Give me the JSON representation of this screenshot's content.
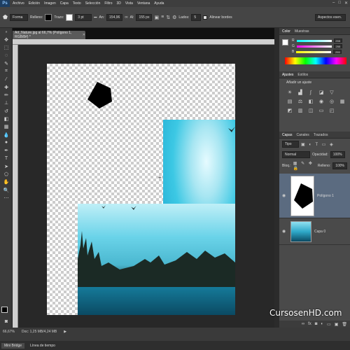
{
  "app": {
    "logo": "Ps"
  },
  "menu": [
    "Archivo",
    "Edición",
    "Imagen",
    "Capa",
    "Texto",
    "Selección",
    "Filtro",
    "3D",
    "Vista",
    "Ventana",
    "Ayuda"
  ],
  "options": {
    "mode": "Forma",
    "fill_label": "Relleno:",
    "stroke_label": "Trazo:",
    "stroke_width": "3 pt",
    "w_label": "An:",
    "w_value": "154,96",
    "h_label": "Al:",
    "h_value": "155 px",
    "sides_label": "Lados:",
    "sides_value": "5",
    "align_edges": "Alinear bordes",
    "workspace": "Aspectos esen."
  },
  "document": {
    "tab": "Art_Nature.jpg al 66,7% (Polígono 1, RGB/8#) *"
  },
  "panels": {
    "color": {
      "tabs": [
        "Color",
        "Muestras"
      ],
      "r": "255",
      "g": "255",
      "b": "255",
      "r_label": "R",
      "g_label": "G",
      "b_label": "B"
    },
    "adjust": {
      "tabs": [
        "Ajustes",
        "Estilos"
      ],
      "title": "Añadir un ajuste"
    },
    "layers": {
      "tabs": [
        "Capas",
        "Canales",
        "Trazados"
      ],
      "kind": "Tipo",
      "blend": "Normal",
      "opacity_label": "Opacidad:",
      "opacity": "100%",
      "lock_label": "Bloq.:",
      "fill_label": "Relleno:",
      "fill": "100%",
      "items": [
        {
          "name": "Polígono 1"
        },
        {
          "name": "Capa 0"
        }
      ]
    }
  },
  "status": {
    "zoom": "66,67%",
    "doc": "Doc: 1,25 MB/4,24 MB",
    "bottom_tabs": [
      "Mini Bridge",
      "Línea de tiempo"
    ]
  },
  "watermark": "CursosenHD.com"
}
